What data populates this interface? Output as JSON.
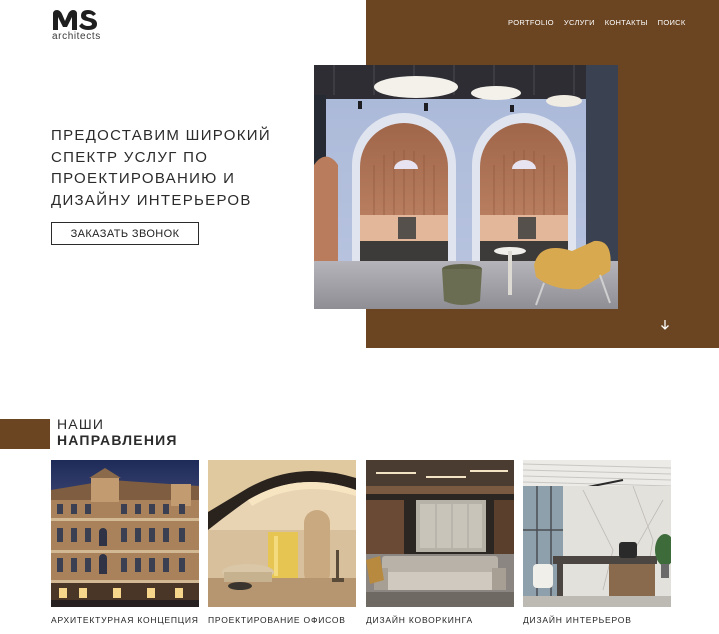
{
  "logo": {
    "mark": "MS",
    "subtitle": "architects"
  },
  "nav": {
    "items": [
      "PORTFOLIO",
      "УСЛУГИ",
      "КОНТАКТЫ",
      "ПОИСК"
    ]
  },
  "hero": {
    "title_lines": [
      "ПРЕДОСТАВИМ ШИРОКИЙ",
      "СПЕКТР УСЛУГ ПО",
      "ПРОЕКТИРОВАНИЮ И",
      "ДИЗАЙНУ ИНТЕРЬЕРОВ"
    ],
    "cta_label": "ЗАКАЗАТЬ ЗВОНОК"
  },
  "directions": {
    "title_line1": "НАШИ",
    "title_line2": "НАПРАВЛЕНИЯ",
    "cards": [
      {
        "caption": "АРХИТЕКТУРНАЯ КОНЦЕПЦИЯ"
      },
      {
        "caption": "ПРОЕКТИРОВАНИЕ ОФИСОВ"
      },
      {
        "caption": "ДИЗАЙН КОВОРКИНГА"
      },
      {
        "caption": "ДИЗАЙН ИНТЕРЬЕРОВ"
      }
    ]
  },
  "colors": {
    "accent_brown": "#6b4522",
    "text_dark": "#2b2b2b",
    "background": "#ffffff"
  },
  "icons": {
    "scroll": "arrow-down-icon"
  }
}
